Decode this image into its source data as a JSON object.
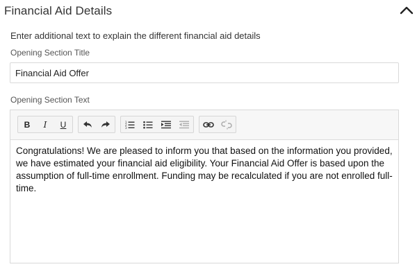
{
  "header": {
    "title": "Financial Aid Details",
    "collapse_icon": "chevron-up-icon"
  },
  "description": "Enter additional text to explain the different financial aid details",
  "opening_title": {
    "label": "Opening Section Title",
    "value": "Financial Aid Offer"
  },
  "opening_text": {
    "label": "Opening Section Text",
    "toolbar": {
      "bold_label": "B",
      "italic_label": "I",
      "underline_label": "U",
      "icons": [
        "undo-icon",
        "redo-icon",
        "ordered-list-icon",
        "unordered-list-icon",
        "indent-icon",
        "outdent-icon",
        "link-icon",
        "unlink-icon"
      ]
    },
    "content": "Congratulations! We are pleased to inform you that based on the information you provided, we have estimated your financial aid eligibility. Your Financial Aid Offer is based upon the assumption of full-time enrollment. Funding may be recalculated if you are not enrolled full-time."
  }
}
